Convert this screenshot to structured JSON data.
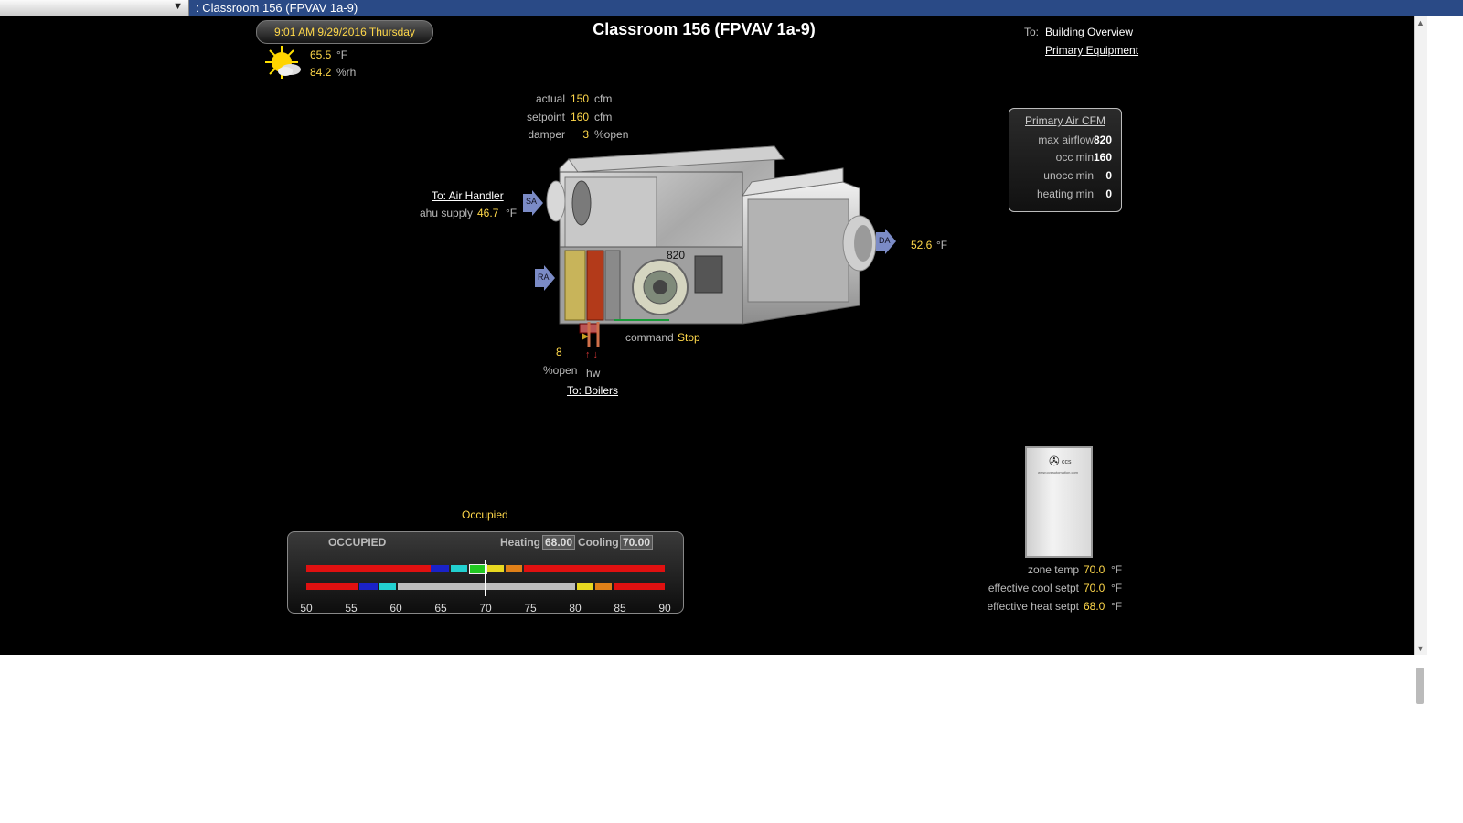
{
  "window": {
    "breadcrumb": ": Classroom 156 (FPVAV 1a-9)"
  },
  "header": {
    "datetime": "9:01 AM  9/29/2016 Thursday",
    "title": "Classroom 156 (FPVAV 1a-9)",
    "nav_prefix": "To:",
    "nav_links": [
      "Building Overview",
      "Primary Equipment"
    ]
  },
  "weather": {
    "temp": "65.5",
    "temp_unit": "°F",
    "humidity": "84.2",
    "humidity_unit": "%rh"
  },
  "airflow": {
    "actual_label": "actual",
    "actual": "150",
    "actual_unit": "cfm",
    "setpoint_label": "setpoint",
    "setpoint": "160",
    "setpoint_unit": "cfm",
    "damper_label": "damper",
    "damper": "3",
    "damper_unit": "%open"
  },
  "air_handler": {
    "link": "To: Air Handler",
    "supply_label": "ahu supply",
    "supply": "46.7",
    "unit": "°F"
  },
  "unit": {
    "sa_tag": "SA",
    "ra_tag": "RA",
    "da_tag": "DA",
    "fan_value": "820",
    "discharge": "52.6",
    "discharge_unit": "°F",
    "command_label": "command",
    "command": "Stop"
  },
  "valve": {
    "value": "8",
    "unit_label": "%open",
    "hw_label": "hw",
    "boilers_link": "To: Boilers"
  },
  "primary_air_cfm": {
    "title": "Primary Air CFM",
    "rows": [
      {
        "label": "max airflow",
        "value": "820"
      },
      {
        "label": "occ min",
        "value": "160"
      },
      {
        "label": "unocc min",
        "value": "0"
      },
      {
        "label": "heating min",
        "value": "0"
      }
    ]
  },
  "occupancy": {
    "status": "Occupied"
  },
  "schedule": {
    "mode": "OCCUPIED",
    "heating_label": "Heating",
    "heating": "68.00",
    "cooling_label": "Cooling",
    "cooling": "70.00",
    "ticks": [
      "50",
      "55",
      "60",
      "65",
      "70",
      "75",
      "80",
      "85",
      "90"
    ],
    "range": [
      50,
      90
    ],
    "current": 70
  },
  "thermostat": {
    "brand_text": "ccs",
    "url_text": "www.ccsautomation.com"
  },
  "zone": {
    "zone_temp_label": "zone temp",
    "zone_temp": "70.0",
    "cool_label": "effective cool setpt",
    "cool": "70.0",
    "heat_label": "effective heat setpt",
    "heat": "68.0",
    "unit": "°F"
  },
  "colors": {
    "value": "#ffd84a",
    "topbar": "#2a4a86"
  }
}
